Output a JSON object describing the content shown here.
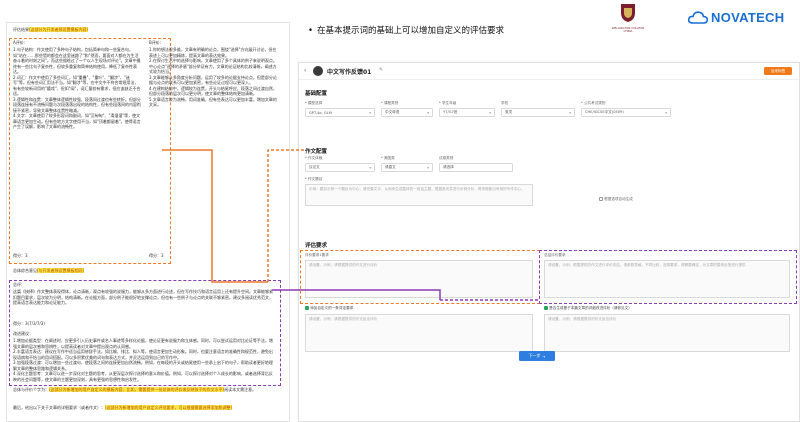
{
  "slide": {
    "bullet": "在基本提示词的基础上可以增加自定义的评估要求"
  },
  "logos": {
    "school_name_line1": "WELLINGTON COLLEGE",
    "school_name_line2": "CHINA",
    "school_name_cn": "惠灵顿(中国)",
    "novatech": "NOVATECH"
  },
  "doc": {
    "eval_title": "评估结果",
    "eval_title_hl": "(这部分为开发者预设置模板内容)",
    "col_left_head": "A评价:",
    "col_right_head": "B评价:",
    "left_para": "1.句子结构：作文使用了多种句子结构，包括简单句和一些复合句，如\"站在……那些墙的都会在这里迷路了\"和\"然而，要面对人都在为生活奋斗着的时刻之间\"。而这些描绘过了一个以人生现场对评论\"。文章中最终有一些比句子复杂性，但较多重复和简单结构使用，降低了复杂性表达。\n2.词汇：作文中使用了多些词汇，如\"重叠\"、\"重叶\"、\"翻涉\"、\"迷写\"等，但有些词汇用法不当，如\"翻涉\"等，在中文中不符合常规用法，有有些较新词用的\"嬉戏\"、但如\"阔\"，词汇量较有需求，但应该缺乏不合适。\n3.逻辑性和连贯：文章整体逻辑性较强，段落间过渡也有些转折。但部分段落连接有不流畅问题与次段落落出现的结构性，但有些段落间的内容衔接不紧密，导致文章整体连贯性略减。\n4.文字：文章使用了较多形容词和副词，如\"沉甸甸\"、\"滑溜溜\"等，使文章语言更加生动。但有些地方文字使用不当，如\"顶着都留着\"。使得语言产生了误解，影响了文章的流畅性。",
    "right_para": "1.你的想法很多维，文章有明确的论点，围绕\"选择\"方向展开讨论，但在表述上可以更加精炼，提高文章的表达效果。\n2.在探讨生活中的选择与影响，文章使用了多个具体的例子来说明观点。中心论点\"选择的矛盾\"部分举证有力，文章的论证结构比较清晰，阐述方式较为恰当。\n3.文章能够从多角度分析问题，运用了较多的论据支持论点。但是部分论据与论点的联系可以更加紧密，有些论证过程可以更深入。\n4.在建构结构中，逻辑较为连贯，开头与结尾呼应，段落之间过渡自然，但部分段落的层次可以更分明，使文章的整体结构更加清晰。\n5.文章语言较为流畅，用词准确，但有些表达可以更加丰富，增加文章的文采。",
    "score_left": "得分：3",
    "score_right": "得分：3",
    "overall_title": "总体综合意见",
    "overall_hl": "(与开发者预设置模板相同)",
    "overall_head": "总评:",
    "overall_text": "这篇《抉择》作文整体表现得体，论点清晰，观点有较强的说服力，能够从多方面进行论述，但在写作技巧和语言运用上还有提升空间。文章能够紧扣题目要求，层次较为分明，结构清晰。在论据方面，部分例子能很好地支撑论点，但也有一些例子与论点的关联不够紧密。建议多阅读优秀范文，提高语言表达能力和论证能力。",
    "score_total": "得分：3(7/3/7/3)",
    "improve_title": "改进建议：",
    "improve_text": "1.增加论据类型：在阐述时，应更多引入历史事件或名人事迹等多样化论据，使论证更有说服力和立体感。同时，可以尝试运用对比论证等手法，增强文章的层次感和思辨性，以提高读者对文章中提出观点的认同感。\n2.丰富语言表达：建议在写作中适当运用修辞手法，如比喻、排比、拟人等，使语言更加生动形象。同时，也要注意语言的准确性和规范性，避免出现语病和不恰当的用词搭配。可以多积累优美的词句和表达方式，并灵活运用到自己的写作中。\n3.加强段落过渡：可以增加一些过渡句，使段落之间的连接更加自然流畅。例如，在每段的开头或结尾使用一些承上启下的句子，帮助读者更好地理解文章的整体思路和逻辑关系。\n4.深化主题思考：文章可以进一步深化对主题的思考，从更深层次探讨选择的意义和价值。例如，可以探讨选择对个人成长的影响，或者选择背后反映的社会问题等，使文章的主题更加深刻，具有更强的思想性和启发性。",
    "extra1_label": "总体与评价个字为：",
    "extra1_hl": "(这部分为新增加的用户自定义的模板内容，比如，需要提供一份总体的评价来反映孩子的作文水平)",
    "extra1_tail": "阅读本文需注意。",
    "extra2_label": "最后，给出以下关于文章的详细要求（或者作文）：",
    "extra2_hl": "(这部分为新增加的用户自定义评估要求，可以根据需要选择添加和调整)"
  },
  "app": {
    "title": "中文写作反馈01",
    "top_button": "后来标签",
    "basic_section": "基础配置",
    "fields_row1": [
      {
        "label": "* 模型选择",
        "value": "GPT-4o, GLM",
        "arrow": true
      },
      {
        "label": "* 课程类别",
        "value": "中文母语",
        "arrow": true
      },
      {
        "label": "* 学生年级",
        "value": "Y7/G7班",
        "arrow": true
      },
      {
        "label": "学校",
        "value": "惠灵",
        "arrow": true
      },
      {
        "label": "* 公共考试类别",
        "value": "CHE/IGCSE中文(0509)",
        "arrow": true
      }
    ],
    "writing_section": "作文配置",
    "fields_row2": [
      {
        "label": "* 作文体裁",
        "value": "议论文",
        "arrow": true
      },
      {
        "label": "* 美国类",
        "value": "请直文",
        "arrow": true
      },
      {
        "label": "试卷类别",
        "value": "请选择",
        "arrow": false
      }
    ],
    "prompt_label": "* 作文题目",
    "prompt_placeholder": "示例：题目示例一个题目为中心，请完善文字，从而来生成整体的一段话主题，根据各块并进行示例分析，再来推断出有用的写作中心。",
    "checkbox_ref": "根据选项自动生成",
    "eval_section": "评估要求",
    "req1_label": "评价要求1要求",
    "req1_placeholder": "请设置，示例，请根据提供的作文进行评价",
    "req2_label": "总结评价要求",
    "req2_placeholder": "请设置，示例，根据提供的作文进行评价总结，请参照表格，不同比较，选择要求，请需要确定，为文章的整体反馈进行提供",
    "check_a": "添加自定义的一条评定要求",
    "check_b": "是否生成基于本篇文章的详细改进评析（请参见文）",
    "area_a_placeholder": "请设置，示例，请根据提供的作文给出评价",
    "area_b_placeholder": "请设置，示例，请根据提供的作文给出评价",
    "next_button": "下一步",
    "next_arrow": "→"
  },
  "colors": {
    "orange": "#ee7a2a",
    "purple": "#8c3cb5",
    "highlight": "#f7e84a",
    "novatech_blue": "#1a6fd1"
  }
}
